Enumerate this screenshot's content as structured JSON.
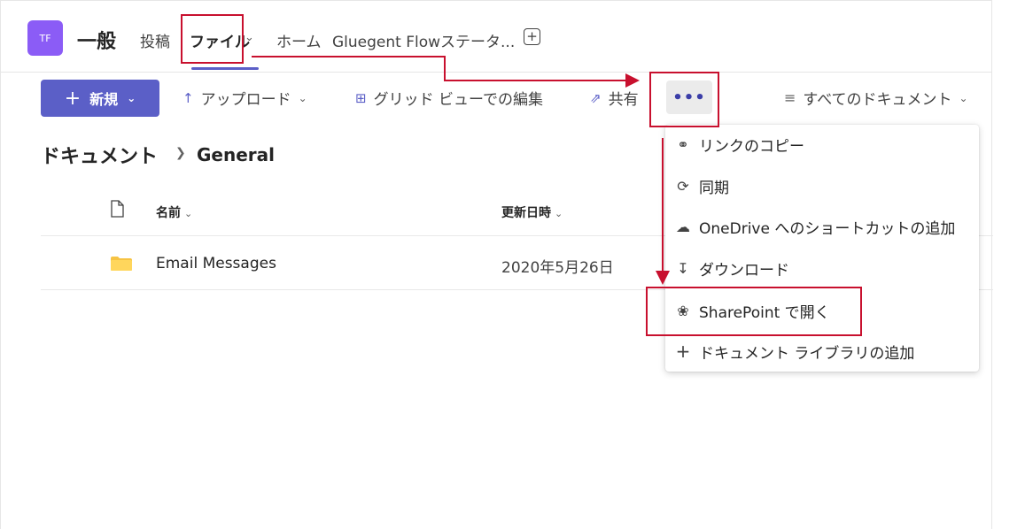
{
  "header": {
    "team_avatar": "TF",
    "channel_name": "一般",
    "tabs": [
      {
        "label": "投稿"
      },
      {
        "label": "ファイル"
      },
      {
        "label": "ホーム"
      },
      {
        "label": "Gluegent Flowステータ..."
      }
    ]
  },
  "toolbar": {
    "new_label": "新規",
    "upload_label": "アップロード",
    "grid_edit_label": "グリッド ビューでの編集",
    "share_label": "共有",
    "more_label": "•••",
    "view_label": "すべてのドキュメント"
  },
  "breadcrumb": {
    "root": "ドキュメント",
    "current": "General"
  },
  "table": {
    "columns": [
      "名前",
      "更新日時"
    ],
    "rows": [
      {
        "name": "Email Messages",
        "modified": "2020年5月26日"
      }
    ]
  },
  "menu": {
    "items": [
      {
        "label": "リンクのコピー",
        "icon": "link-icon"
      },
      {
        "label": "同期",
        "icon": "sync-icon"
      },
      {
        "label": "OneDrive へのショートカットの追加",
        "icon": "onedrive-shortcut-icon"
      },
      {
        "label": "ダウンロード",
        "icon": "download-icon"
      },
      {
        "label": "SharePoint で開く",
        "icon": "sharepoint-icon"
      },
      {
        "label": "ドキュメント ライブラリの追加",
        "icon": "plus-icon"
      }
    ]
  },
  "colors": {
    "accent": "#5b5fc7",
    "avatar": "#8b5cf6",
    "annotation": "#c8102e",
    "folder": "#f6c343"
  }
}
